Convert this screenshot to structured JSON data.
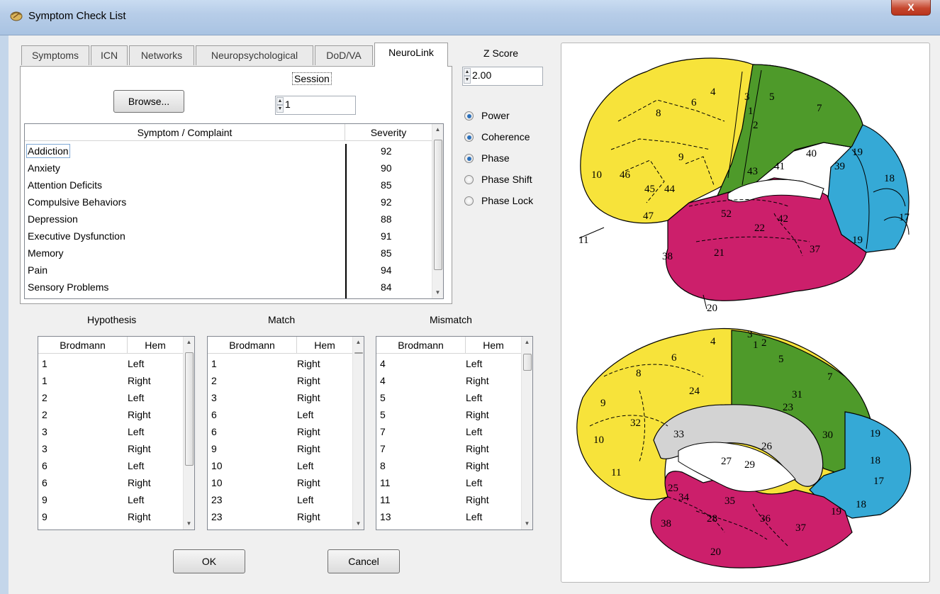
{
  "window": {
    "title": "Symptom Check List",
    "close_label": "X"
  },
  "tabs": [
    {
      "label": "Symptoms"
    },
    {
      "label": "ICN"
    },
    {
      "label": "Networks"
    },
    {
      "label": "Neuropsychological"
    },
    {
      "label": "DoD/VA"
    },
    {
      "label": "NeuroLink"
    }
  ],
  "active_tab": "NeuroLink",
  "neurolink": {
    "browse_label": "Browse...",
    "session_label": "Session",
    "session_value": "1"
  },
  "symptom_table": {
    "headers": [
      "Symptom / Complaint",
      "Severity"
    ],
    "rows": [
      {
        "symptom": "Addiction",
        "severity": "92"
      },
      {
        "symptom": "Anxiety",
        "severity": "90"
      },
      {
        "symptom": "Attention Deficits",
        "severity": "85"
      },
      {
        "symptom": "Compulsive Behaviors",
        "severity": "92"
      },
      {
        "symptom": "Depression",
        "severity": "88"
      },
      {
        "symptom": "Executive Dysfunction",
        "severity": "91"
      },
      {
        "symptom": "Memory",
        "severity": "85"
      },
      {
        "symptom": "Pain",
        "severity": "94"
      },
      {
        "symptom": "Sensory Problems",
        "severity": "84"
      }
    ]
  },
  "zscore": {
    "label": "Z Score",
    "value": "2.00"
  },
  "options": [
    {
      "label": "Power",
      "checked": true
    },
    {
      "label": "Coherence",
      "checked": true
    },
    {
      "label": "Phase",
      "checked": true
    },
    {
      "label": "Phase Shift",
      "checked": false
    },
    {
      "label": "Phase Lock",
      "checked": false
    }
  ],
  "hypothesis": {
    "title": "Hypothesis",
    "headers": [
      "Brodmann",
      "Hem"
    ],
    "rows": [
      [
        "1",
        "Left"
      ],
      [
        "1",
        "Right"
      ],
      [
        "2",
        "Left"
      ],
      [
        "2",
        "Right"
      ],
      [
        "3",
        "Left"
      ],
      [
        "3",
        "Right"
      ],
      [
        "6",
        "Left"
      ],
      [
        "6",
        "Right"
      ],
      [
        "9",
        "Left"
      ],
      [
        "9",
        "Right"
      ]
    ]
  },
  "match": {
    "title": "Match",
    "headers": [
      "Brodmann",
      "Hem"
    ],
    "rows": [
      [
        "1",
        "Right"
      ],
      [
        "2",
        "Right"
      ],
      [
        "3",
        "Right"
      ],
      [
        "6",
        "Left"
      ],
      [
        "6",
        "Right"
      ],
      [
        "9",
        "Right"
      ],
      [
        "10",
        "Left"
      ],
      [
        "10",
        "Right"
      ],
      [
        "23",
        "Left"
      ],
      [
        "23",
        "Right"
      ]
    ]
  },
  "mismatch": {
    "title": "Mismatch",
    "headers": [
      "Brodmann",
      "Hem"
    ],
    "rows": [
      [
        "4",
        "Left"
      ],
      [
        "4",
        "Right"
      ],
      [
        "5",
        "Left"
      ],
      [
        "5",
        "Right"
      ],
      [
        "7",
        "Left"
      ],
      [
        "7",
        "Right"
      ],
      [
        "8",
        "Right"
      ],
      [
        "11",
        "Left"
      ],
      [
        "11",
        "Right"
      ],
      [
        "13",
        "Left"
      ]
    ]
  },
  "buttons": {
    "ok_label": "OK",
    "cancel_label": "Cancel"
  },
  "brain_colors": {
    "frontal": "#f7e33a",
    "motor_parietal": "#4e9a2a",
    "occipital": "#35a9d6",
    "temporal": "#cc1f6b",
    "callosum": "#d3d3d3"
  },
  "lateral_labels": [
    "4",
    "6",
    "3",
    "5",
    "1",
    "7",
    "8",
    "2",
    "9",
    "40",
    "19",
    "43",
    "41",
    "39",
    "10",
    "46",
    "45",
    "44",
    "18",
    "52",
    "42",
    "47",
    "22",
    "17",
    "11",
    "19",
    "38",
    "21",
    "37",
    "20"
  ],
  "medial_labels": [
    "4",
    "3",
    "1",
    "2",
    "6",
    "5",
    "8",
    "7",
    "24",
    "31",
    "9",
    "23",
    "32",
    "33",
    "30",
    "19",
    "10",
    "26",
    "27",
    "29",
    "18",
    "11",
    "17",
    "25",
    "18",
    "34",
    "35",
    "28",
    "36",
    "19",
    "38",
    "37",
    "20"
  ]
}
